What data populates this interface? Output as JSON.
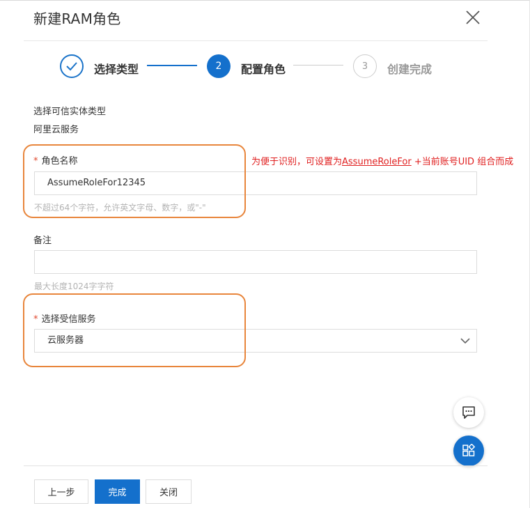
{
  "dialog": {
    "title": "新建RAM角色"
  },
  "steps": [
    {
      "label": "选择类型",
      "state": "done"
    },
    {
      "label": "配置角色",
      "number": "2",
      "state": "active"
    },
    {
      "label": "创建完成",
      "number": "3",
      "state": "pending"
    }
  ],
  "entity": {
    "label": "选择可信实体类型",
    "value": "阿里云服务"
  },
  "role_name": {
    "label": "角色名称",
    "value": "AssumeRoleFor12345",
    "hint": "不超过64个字符，允许英文字母、数字，或\"-\""
  },
  "annotation": {
    "prefix": "为便于识别，可设置为",
    "underlined": "AssumeRoleFor",
    "suffix": " +当前账号UID 组合而成"
  },
  "remark": {
    "label": "备注",
    "value": "",
    "hint": "最大长度1024字字符"
  },
  "service": {
    "label": "选择受信服务",
    "selected": "云服务器"
  },
  "buttons": {
    "prev": "上一步",
    "finish": "完成",
    "close": "关闭"
  },
  "icons": {
    "close": "close-icon",
    "check": "check-icon",
    "chevron": "chevron-down-icon",
    "chat": "chat-icon",
    "apps": "apps-icon"
  },
  "colors": {
    "primary": "#1470cc",
    "required": "#e0492f",
    "annotation": "#e8853b",
    "annotation_text": "#e02020"
  }
}
